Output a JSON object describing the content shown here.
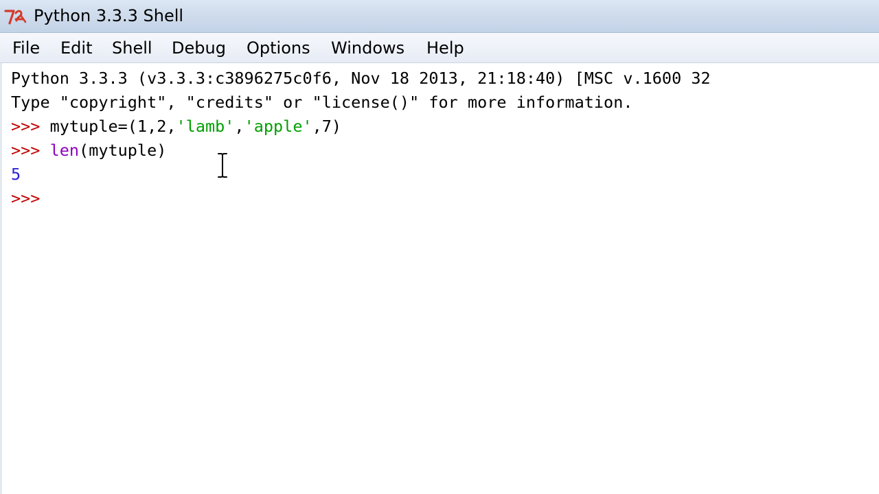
{
  "window": {
    "title": "Python 3.3.3 Shell",
    "app_icon": "idle-python-icon"
  },
  "menu": {
    "items": [
      "File",
      "Edit",
      "Shell",
      "Debug",
      "Options",
      "Windows",
      "Help"
    ]
  },
  "shell": {
    "banner_line1": "Python 3.3.3 (v3.3.3:c3896275c0f6, Nov 18 2013, 21:18:40) [MSC v.1600 32",
    "banner_line2": "Type \"copyright\", \"credits\" or \"license()\" for more information.",
    "prompt": ">>> ",
    "input1": {
      "code_start": "mytuple=(1,2,",
      "str1": "'lamb'",
      "comma": ",",
      "str2": "'apple'",
      "code_end": ",7)"
    },
    "input2": {
      "builtin": "len",
      "code_rest": "(mytuple)"
    },
    "output1": "5",
    "current_prompt": ">>>"
  },
  "colors": {
    "prompt": "#c00000",
    "builtin": "#8f00bf",
    "string": "#00a000",
    "output": "#2b20d8",
    "text": "#000000"
  },
  "cursor": "ibeam-cursor-icon"
}
